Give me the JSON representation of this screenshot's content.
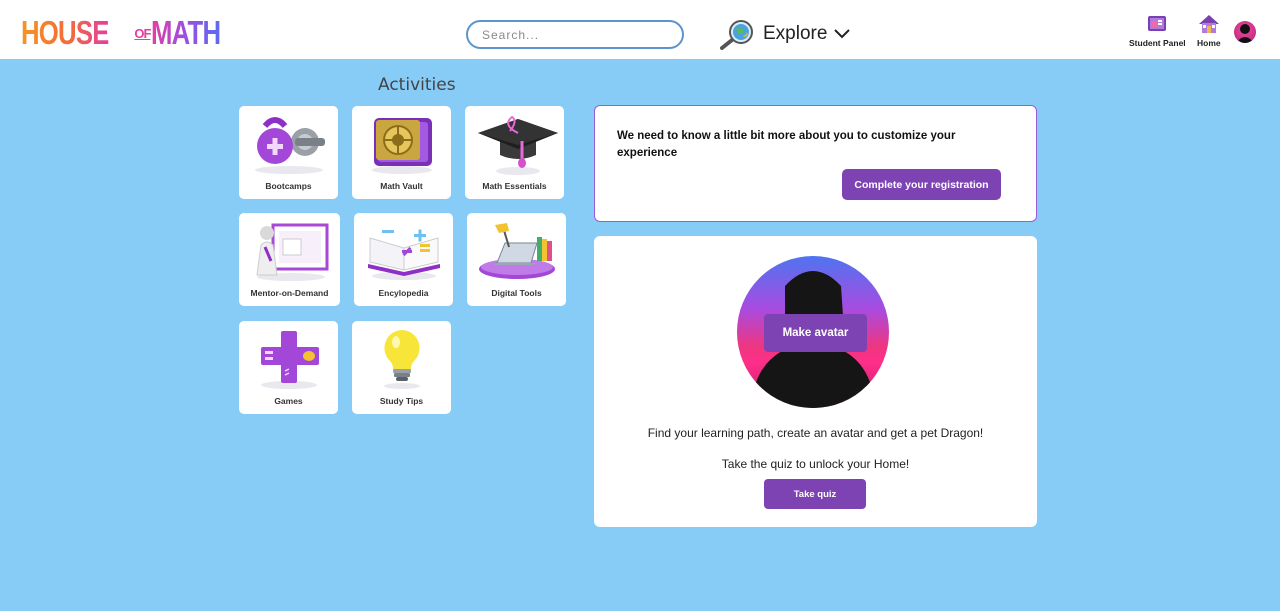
{
  "header": {
    "logo": {
      "part1": "HOUSE",
      "part2": "OF",
      "part3": "MATH"
    },
    "search": {
      "placeholder": "Search...",
      "value": ""
    },
    "explore_label": "Explore",
    "nav": [
      {
        "label": "Student Panel",
        "icon": "student-panel-icon"
      },
      {
        "label": "Home",
        "icon": "home-icon"
      }
    ],
    "avatar_icon": "user-avatar-icon"
  },
  "activities": {
    "title": "Activities",
    "tiles": [
      {
        "label": "Bootcamps",
        "icon": "kettlebell-icon"
      },
      {
        "label": "Math Vault",
        "icon": "vault-icon"
      },
      {
        "label": "Math Essentials",
        "icon": "graduation-cap-icon"
      },
      {
        "label": "Mentor-on-Demand",
        "icon": "mentor-whiteboard-icon"
      },
      {
        "label": "Encylopedia",
        "icon": "open-book-icon"
      },
      {
        "label": "Digital Tools",
        "icon": "laptop-tools-icon"
      },
      {
        "label": "Games",
        "icon": "game-cross-icon"
      },
      {
        "label": "Study Tips",
        "icon": "lightbulb-icon"
      }
    ]
  },
  "registration": {
    "text": "We need to know a little bit more about you to customize your experience",
    "button": "Complete your registration"
  },
  "avatar_card": {
    "make_avatar": "Make avatar",
    "line1": "Find your learning path, create an avatar and get a pet Dragon!",
    "line2": "Take the quiz to unlock your Home!",
    "quiz_button": "Take quiz"
  },
  "colors": {
    "background": "#87ccf7",
    "accent_purple": "#7e43b3",
    "card_border": "#9b5cd9",
    "logo_orange": "#f7941d",
    "logo_pink": "#e23fa2",
    "logo_purple": "#7b4fe8"
  }
}
